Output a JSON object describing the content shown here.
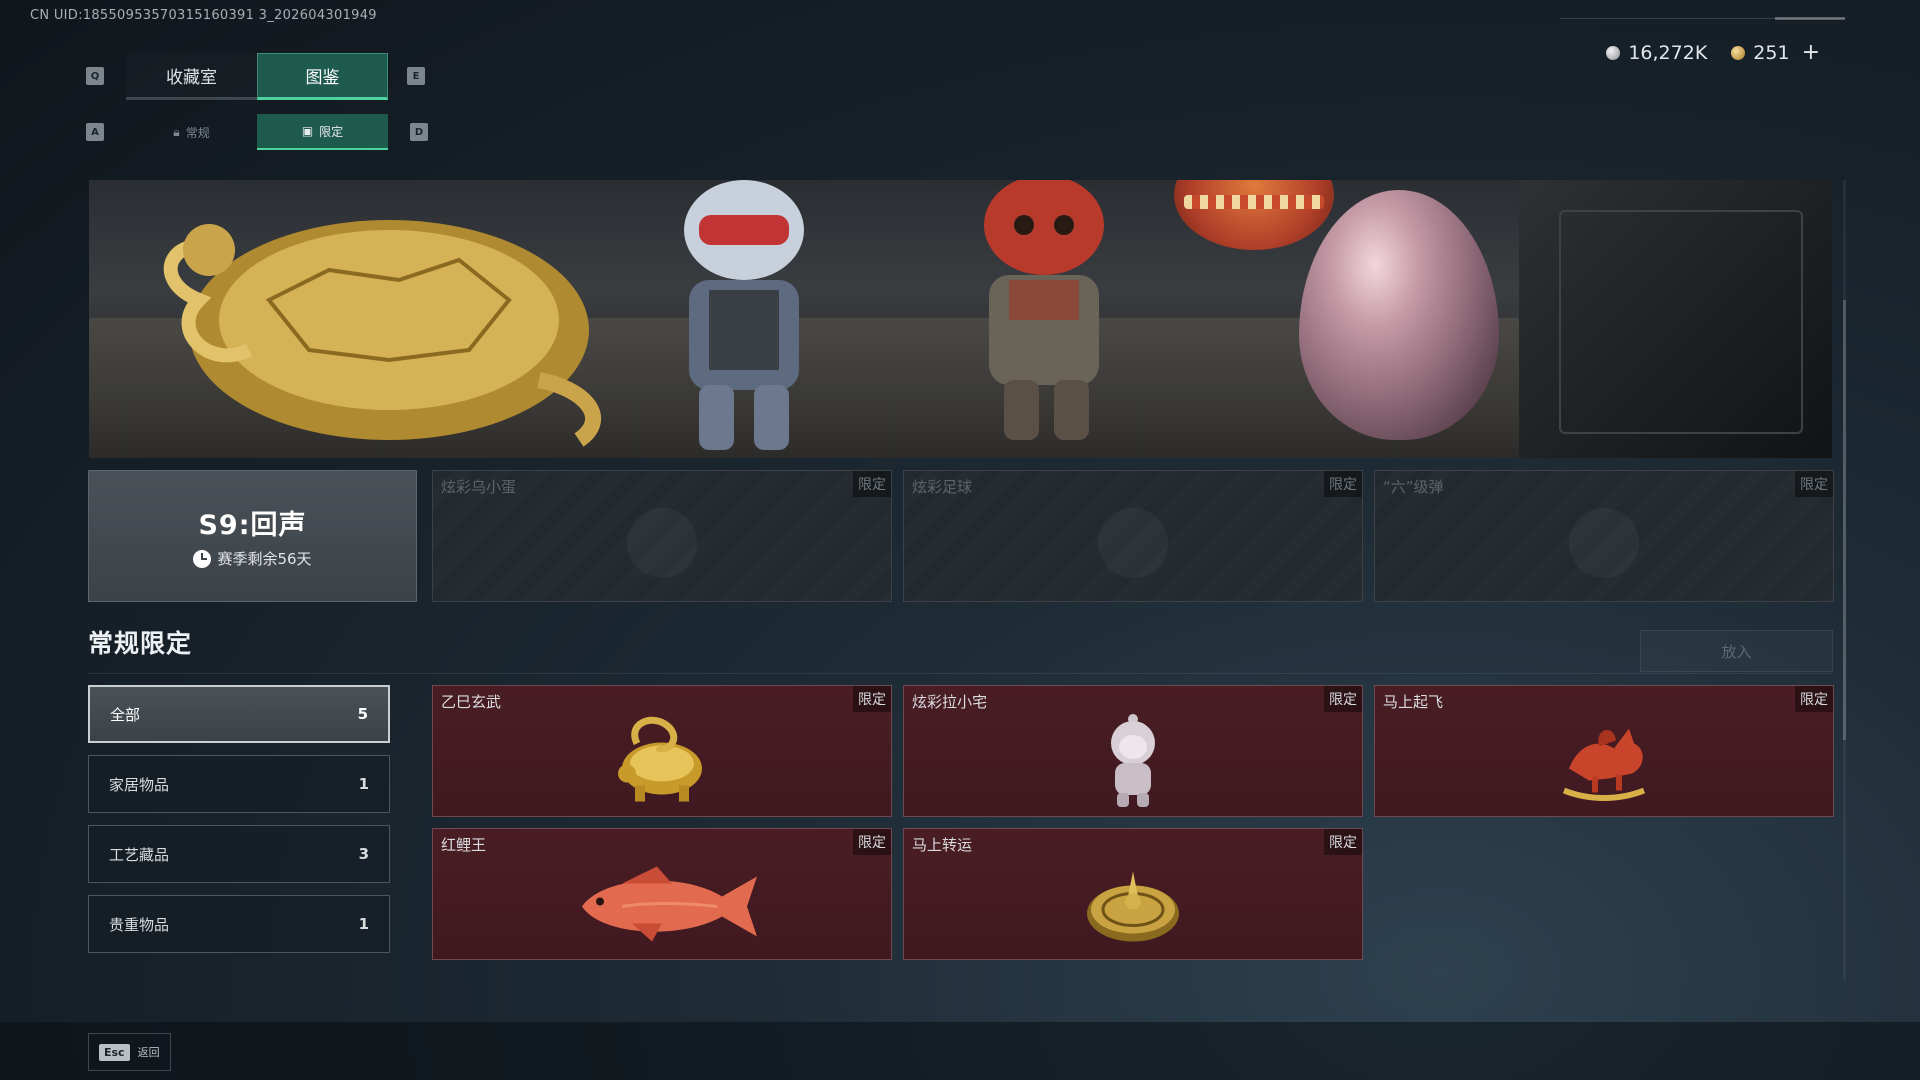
{
  "header": {
    "uid": "CN UID:18550953570315160391 3_202604301949"
  },
  "currency": {
    "silver": "16,272K",
    "gold": "251",
    "plus": "+"
  },
  "tabs": {
    "key_left": "Q",
    "key_right": "E",
    "items": [
      {
        "label": "收藏室"
      },
      {
        "label": "图鉴"
      }
    ]
  },
  "subtabs": {
    "key_left": "A",
    "key_right": "D",
    "items": [
      {
        "label": "常规"
      },
      {
        "label": "限定"
      }
    ]
  },
  "season": {
    "title": "S9:回声",
    "remaining": "赛季剩余56天"
  },
  "locked_cards": [
    {
      "name": "炫彩乌小蛋",
      "tag": "限定"
    },
    {
      "name": "炫彩足球",
      "tag": "限定"
    },
    {
      "name": "“六”级弹",
      "tag": "限定"
    }
  ],
  "section": {
    "title": "常规限定",
    "put_button": "放入"
  },
  "categories": [
    {
      "label": "全部",
      "count": "5"
    },
    {
      "label": "家居物品",
      "count": "1"
    },
    {
      "label": "工艺藏品",
      "count": "3"
    },
    {
      "label": "贵重物品",
      "count": "1"
    }
  ],
  "items": [
    {
      "name": "乙巳玄武",
      "tag": "限定"
    },
    {
      "name": "炫彩拉小宅",
      "tag": "限定"
    },
    {
      "name": "马上起飞",
      "tag": "限定"
    },
    {
      "name": "红鲤王",
      "tag": "限定"
    },
    {
      "name": "马上转运",
      "tag": "限定"
    }
  ],
  "footer": {
    "esc_key": "Esc",
    "esc_label": "返回"
  },
  "colors": {
    "accent": "#4fd39e",
    "tab_active_bg": "#1f5a4e",
    "item_card_bg": "#4a1d24"
  }
}
